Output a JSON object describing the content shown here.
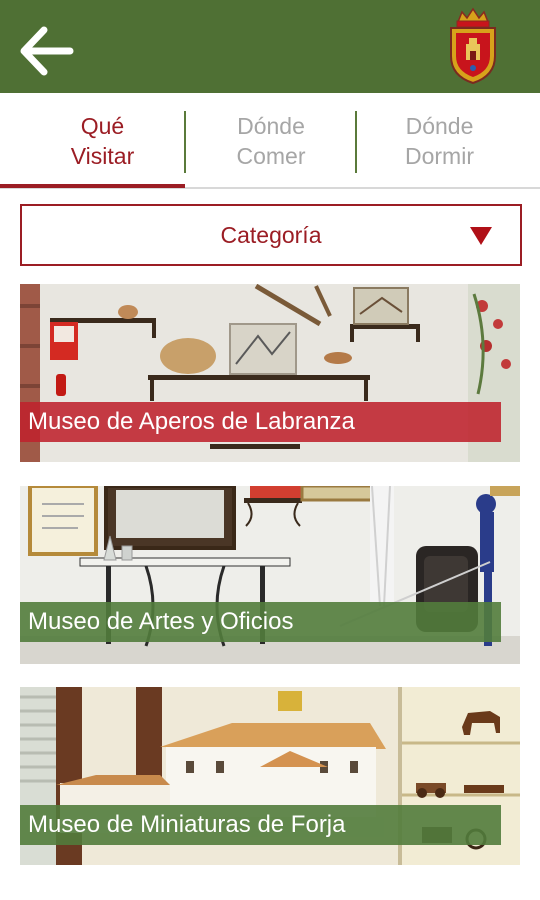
{
  "header": {
    "back_icon": "arrow-left-icon",
    "crest_icon": "municipal-crest-icon",
    "background_color": "#4f7034"
  },
  "tabs": [
    {
      "line1": "Qué",
      "line2": "Visitar",
      "active": true
    },
    {
      "line1": "Dónde",
      "line2": "Comer",
      "active": false
    },
    {
      "line1": "Dónde",
      "line2": "Dormir",
      "active": false
    }
  ],
  "filter": {
    "label": "Categoría",
    "arrow_icon": "triangle-down-icon",
    "accent_color": "#9b1d24"
  },
  "places": [
    {
      "title": "Museo de Aperos de Labranza",
      "label_color": "#be222c"
    },
    {
      "title": "Museo de Artes y Oficios",
      "label_color": "#527c3c"
    },
    {
      "title": "Museo de Miniaturas de Forja",
      "label_color": "#527c3c"
    }
  ]
}
